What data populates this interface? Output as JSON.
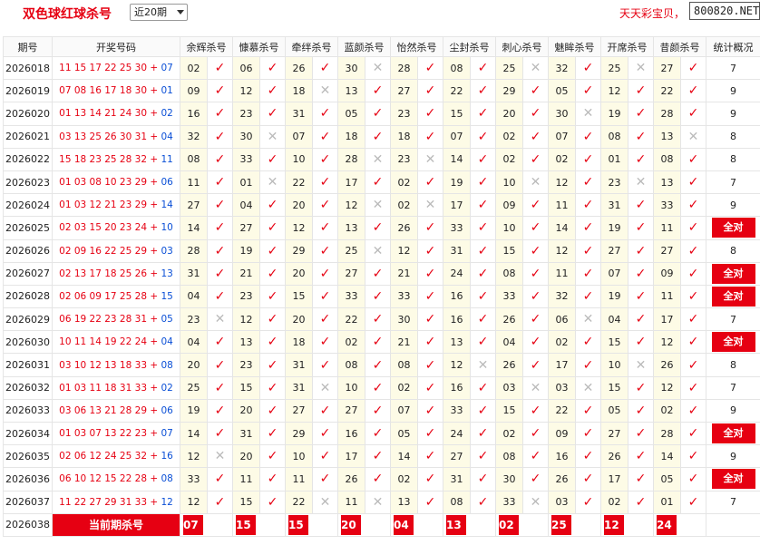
{
  "header": {
    "title": "双色球红球杀号",
    "period_select": "近20期",
    "promo": "天天彩宝贝，",
    "site": "800820.NET"
  },
  "columns": {
    "issue": "期号",
    "draw": "开奖号码",
    "experts": [
      "余辉杀号",
      "慷慕杀号",
      "牵绊杀号",
      "蓝颜杀号",
      "怡然杀号",
      "尘封杀号",
      "刺心杀号",
      "魅眸杀号",
      "开席杀号",
      "昔颜杀号"
    ],
    "stat": "统计概况"
  },
  "rows": [
    {
      "issue": "2026018",
      "red": "11 15 17 22 25 30",
      "blue": "07",
      "kills": [
        "02",
        "06",
        "26",
        "30",
        "28",
        "08",
        "25",
        "32",
        "25",
        "27"
      ],
      "marks": [
        1,
        1,
        1,
        0,
        1,
        1,
        0,
        1,
        0,
        1
      ],
      "stat": "7"
    },
    {
      "issue": "2026019",
      "red": "07 08 16 17 18 30",
      "blue": "01",
      "kills": [
        "09",
        "12",
        "18",
        "13",
        "27",
        "22",
        "29",
        "05",
        "12",
        "22"
      ],
      "marks": [
        1,
        1,
        0,
        1,
        1,
        1,
        1,
        1,
        1,
        1
      ],
      "stat": "9"
    },
    {
      "issue": "2026020",
      "red": "01 13 14 21 24 30",
      "blue": "02",
      "kills": [
        "16",
        "23",
        "31",
        "05",
        "23",
        "15",
        "20",
        "30",
        "19",
        "28"
      ],
      "marks": [
        1,
        1,
        1,
        1,
        1,
        1,
        1,
        0,
        1,
        1
      ],
      "stat": "9"
    },
    {
      "issue": "2026021",
      "red": "03 13 25 26 30 31",
      "blue": "04",
      "kills": [
        "32",
        "30",
        "07",
        "18",
        "18",
        "07",
        "02",
        "07",
        "08",
        "13"
      ],
      "marks": [
        1,
        0,
        1,
        1,
        1,
        1,
        1,
        1,
        1,
        0
      ],
      "stat": "8"
    },
    {
      "issue": "2026022",
      "red": "15 18 23 25 28 32",
      "blue": "11",
      "kills": [
        "08",
        "33",
        "10",
        "28",
        "23",
        "14",
        "02",
        "02",
        "01",
        "08"
      ],
      "marks": [
        1,
        1,
        1,
        0,
        0,
        1,
        1,
        1,
        1,
        1
      ],
      "stat": "8"
    },
    {
      "issue": "2026023",
      "red": "01 03 08 10 23 29",
      "blue": "06",
      "kills": [
        "11",
        "01",
        "22",
        "17",
        "02",
        "19",
        "10",
        "12",
        "23",
        "13"
      ],
      "marks": [
        1,
        0,
        1,
        1,
        1,
        1,
        0,
        1,
        0,
        1
      ],
      "stat": "7"
    },
    {
      "issue": "2026024",
      "red": "01 03 12 21 23 29",
      "blue": "14",
      "kills": [
        "27",
        "04",
        "20",
        "12",
        "02",
        "17",
        "09",
        "11",
        "31",
        "33"
      ],
      "marks": [
        1,
        1,
        1,
        0,
        0,
        1,
        1,
        1,
        1,
        1
      ],
      "stat": "9"
    },
    {
      "issue": "2026025",
      "red": "02 03 15 20 23 24",
      "blue": "10",
      "kills": [
        "14",
        "27",
        "12",
        "13",
        "26",
        "33",
        "10",
        "14",
        "19",
        "11"
      ],
      "marks": [
        1,
        1,
        1,
        1,
        1,
        1,
        1,
        1,
        1,
        1
      ],
      "stat": "全对"
    },
    {
      "issue": "2026026",
      "red": "02 09 16 22 25 29",
      "blue": "03",
      "kills": [
        "28",
        "19",
        "29",
        "25",
        "12",
        "31",
        "15",
        "12",
        "27",
        "27"
      ],
      "marks": [
        1,
        1,
        1,
        0,
        1,
        1,
        1,
        1,
        1,
        1
      ],
      "stat": "8"
    },
    {
      "issue": "2026027",
      "red": "02 13 17 18 25 26",
      "blue": "13",
      "kills": [
        "31",
        "21",
        "20",
        "27",
        "21",
        "24",
        "08",
        "11",
        "07",
        "09"
      ],
      "marks": [
        1,
        1,
        1,
        1,
        1,
        1,
        1,
        1,
        1,
        1
      ],
      "stat": "全对"
    },
    {
      "issue": "2026028",
      "red": "02 06 09 17 25 28",
      "blue": "15",
      "kills": [
        "04",
        "23",
        "15",
        "33",
        "33",
        "16",
        "33",
        "32",
        "19",
        "11"
      ],
      "marks": [
        1,
        1,
        1,
        1,
        1,
        1,
        1,
        1,
        1,
        1
      ],
      "stat": "全对"
    },
    {
      "issue": "2026029",
      "red": "06 19 22 23 28 31",
      "blue": "05",
      "kills": [
        "23",
        "12",
        "20",
        "22",
        "30",
        "16",
        "26",
        "06",
        "04",
        "17"
      ],
      "marks": [
        0,
        1,
        1,
        1,
        1,
        1,
        1,
        0,
        1,
        1
      ],
      "stat": "7"
    },
    {
      "issue": "2026030",
      "red": "10 11 14 19 22 24",
      "blue": "04",
      "kills": [
        "04",
        "13",
        "18",
        "02",
        "21",
        "13",
        "04",
        "02",
        "15",
        "12"
      ],
      "marks": [
        1,
        1,
        1,
        1,
        1,
        1,
        1,
        1,
        1,
        1
      ],
      "stat": "全对"
    },
    {
      "issue": "2026031",
      "red": "03 10 12 13 18 33",
      "blue": "08",
      "kills": [
        "20",
        "23",
        "31",
        "08",
        "08",
        "12",
        "26",
        "17",
        "10",
        "26"
      ],
      "marks": [
        1,
        1,
        1,
        1,
        1,
        0,
        1,
        1,
        0,
        1
      ],
      "stat": "8"
    },
    {
      "issue": "2026032",
      "red": "01 03 11 18 31 33",
      "blue": "02",
      "kills": [
        "25",
        "15",
        "31",
        "10",
        "02",
        "16",
        "03",
        "03",
        "15",
        "12"
      ],
      "marks": [
        1,
        1,
        0,
        1,
        1,
        1,
        0,
        0,
        1,
        1
      ],
      "stat": "7"
    },
    {
      "issue": "2026033",
      "red": "03 06 13 21 28 29",
      "blue": "06",
      "kills": [
        "19",
        "20",
        "27",
        "27",
        "07",
        "33",
        "15",
        "22",
        "05",
        "02"
      ],
      "marks": [
        1,
        1,
        1,
        1,
        1,
        1,
        1,
        1,
        1,
        1
      ],
      "stat": "9"
    },
    {
      "issue": "2026034",
      "red": "01 03 07 13 22 23",
      "blue": "07",
      "kills": [
        "14",
        "31",
        "29",
        "16",
        "05",
        "24",
        "02",
        "09",
        "27",
        "28"
      ],
      "marks": [
        1,
        1,
        1,
        1,
        1,
        1,
        1,
        1,
        1,
        1
      ],
      "stat": "全对"
    },
    {
      "issue": "2026035",
      "red": "02 06 12 24 25 32",
      "blue": "16",
      "kills": [
        "12",
        "20",
        "10",
        "17",
        "14",
        "27",
        "08",
        "16",
        "26",
        "14"
      ],
      "marks": [
        0,
        1,
        1,
        1,
        1,
        1,
        1,
        1,
        1,
        1
      ],
      "stat": "9"
    },
    {
      "issue": "2026036",
      "red": "06 10 12 15 22 28",
      "blue": "08",
      "kills": [
        "33",
        "11",
        "11",
        "26",
        "02",
        "31",
        "30",
        "26",
        "17",
        "05"
      ],
      "marks": [
        1,
        1,
        1,
        1,
        1,
        1,
        1,
        1,
        1,
        1
      ],
      "stat": "全对"
    },
    {
      "issue": "2026037",
      "red": "11 22 27 29 31 33",
      "blue": "12",
      "kills": [
        "12",
        "15",
        "22",
        "11",
        "13",
        "08",
        "33",
        "03",
        "02",
        "01"
      ],
      "marks": [
        1,
        1,
        0,
        0,
        1,
        1,
        0,
        1,
        1,
        1
      ],
      "stat": "7"
    }
  ],
  "current": {
    "issue": "2026038",
    "label": "当前期杀号",
    "kills": [
      "07",
      "15",
      "15",
      "20",
      "04",
      "13",
      "02",
      "25",
      "12",
      "24"
    ]
  }
}
